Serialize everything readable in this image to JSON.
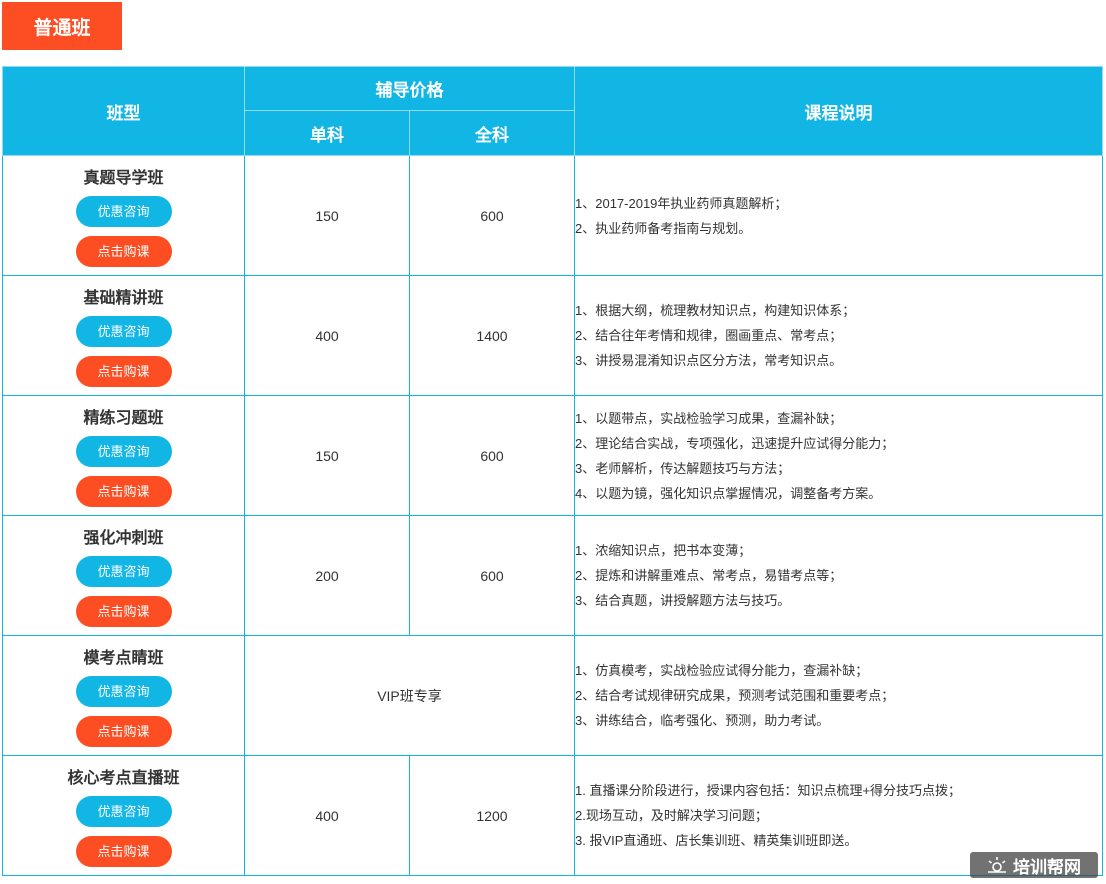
{
  "title_tag": "普通班",
  "header": {
    "col_type": "班型",
    "col_price": "辅导价格",
    "col_single": "单科",
    "col_full": "全科",
    "col_desc": "课程说明"
  },
  "buttons": {
    "consult": "优惠咨询",
    "buy": "点击购课"
  },
  "rows": [
    {
      "name": "真题导学班",
      "single": "150",
      "full": "600",
      "desc": [
        "1、2017-2019年执业药师真题解析；",
        "2、执业药师备考指南与规划。"
      ]
    },
    {
      "name": "基础精讲班",
      "single": "400",
      "full": "1400",
      "desc": [
        "1、根据大纲，梳理教材知识点，构建知识体系；",
        "2、结合往年考情和规律，圈画重点、常考点；",
        "3、讲授易混淆知识点区分方法，常考知识点。"
      ]
    },
    {
      "name": "精练习题班",
      "single": "150",
      "full": "600",
      "desc": [
        "1、以题带点，实战检验学习成果，查漏补缺；",
        "2、理论结合实战，专项强化，迅速提升应试得分能力；",
        "3、老师解析，传达解题技巧与方法；",
        "4、以题为镜，强化知识点掌握情况，调整备考方案。"
      ]
    },
    {
      "name": "强化冲刺班",
      "single": "200",
      "full": "600",
      "desc": [
        "1、浓缩知识点，把书本变薄；",
        "2、提炼和讲解重难点、常考点，易错考点等；",
        "3、结合真题，讲授解题方法与技巧。"
      ]
    },
    {
      "name": "模考点睛班",
      "merged_price": "VIP班专享",
      "desc": [
        "1、仿真模考，实战检验应试得分能力，查漏补缺；",
        "2、结合考试规律研究成果，预测考试范围和重要考点；",
        "3、讲练结合，临考强化、预测，助力考试。"
      ]
    },
    {
      "name": "核心考点直播班",
      "single": "400",
      "full": "1200",
      "desc": [
        "1. 直播课分阶段进行，授课内容包括：知识点梳理+得分技巧点拨；",
        "2.现场互动，及时解决学习问题；",
        "3. 报VIP直通班、店长集训班、精英集训班即送。"
      ]
    }
  ],
  "watermark": "培训帮网",
  "colors": {
    "header_blue": "#12b6e5",
    "accent_orange": "#fc4e22"
  }
}
